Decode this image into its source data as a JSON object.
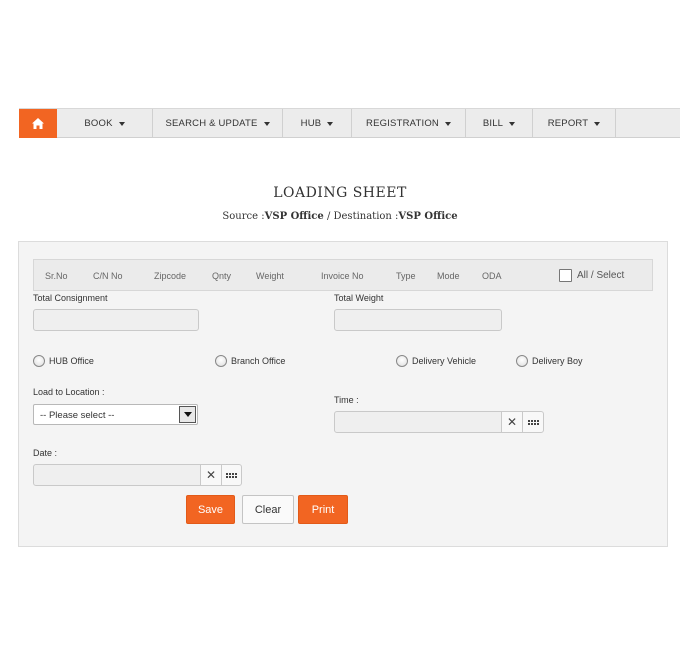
{
  "nav": {
    "home_icon": "home-icon",
    "items": [
      {
        "label": "BOOK"
      },
      {
        "label": "SEARCH & UPDATE"
      },
      {
        "label": "HUB"
      },
      {
        "label": "REGISTRATION"
      },
      {
        "label": "BILL"
      },
      {
        "label": "REPORT"
      }
    ]
  },
  "header": {
    "title": "LOADING SHEET",
    "source_label": "Source :",
    "source_value": "VSP Office",
    "separator": "/",
    "dest_label": "Destination :",
    "dest_value": "VSP Office"
  },
  "table": {
    "columns": [
      "Sr.No",
      "C/N No",
      "Zipcode",
      "Qnty",
      "Weight",
      "Invoice No",
      "Type",
      "Mode",
      "ODA"
    ],
    "all_select": "All / Select"
  },
  "form": {
    "total_consignment_label": "Total Consignment",
    "total_consignment_value": "",
    "total_weight_label": "Total Weight",
    "total_weight_value": "",
    "radios": [
      "HUB Office",
      "Branch Office",
      "Delivery Vehicle",
      "Delivery Boy"
    ],
    "load_location_label": "Load to Location :",
    "load_location_value": "-- Please select --",
    "time_label": "Time :",
    "time_value": "",
    "date_label": "Date :",
    "date_value": "",
    "clear_symbol": "✕"
  },
  "buttons": {
    "save": "Save",
    "clear": "Clear",
    "print": "Print"
  },
  "colors": {
    "accent": "#f26522"
  }
}
